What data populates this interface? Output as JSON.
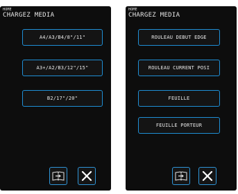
{
  "left_screen": {
    "mode_label": "HOME",
    "title": "CHARGEZ MEDIA",
    "buttons": [
      {
        "label": "A4/A3/B4/8\"/11\""
      },
      {
        "label": "A3+/A2/B3/12\"/15\""
      },
      {
        "label": "B2/17\"/20\""
      }
    ]
  },
  "right_screen": {
    "mode_label": "HOME",
    "title": "CHARGEZ MEDIA",
    "buttons": [
      {
        "label": "ROULEAU DEBUT EDGE"
      },
      {
        "label": "ROULEAU CURRENT POSI"
      },
      {
        "label": "FEUILLE"
      },
      {
        "label": "FEUILLE PORTEUR"
      }
    ]
  },
  "icons": {
    "feed": "book-feed-icon",
    "close": "close-icon"
  },
  "colors": {
    "screen_bg": "#0d0d0d",
    "button_border": "#1f8fd6",
    "text": "#e8e8e8"
  }
}
